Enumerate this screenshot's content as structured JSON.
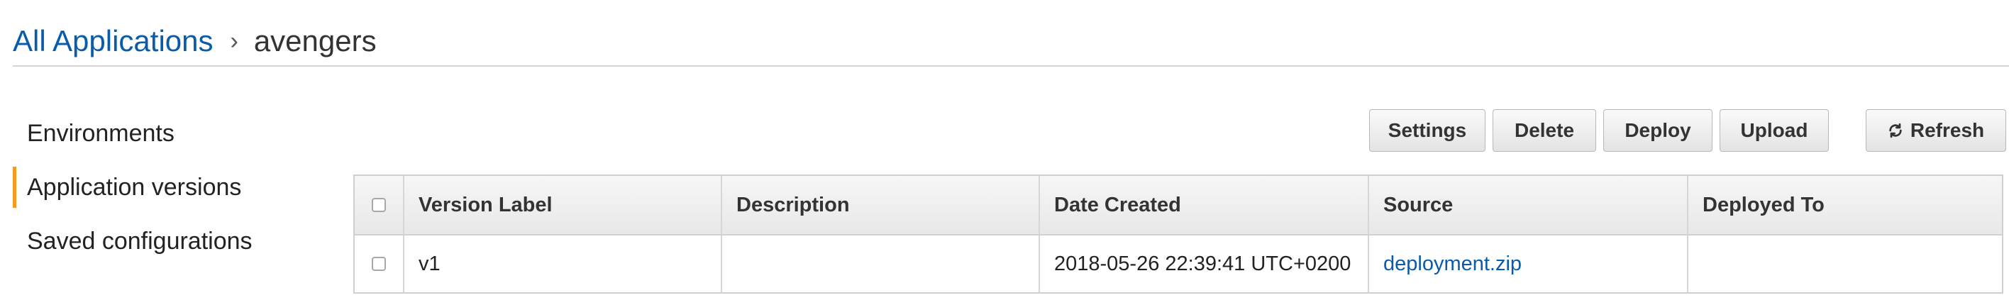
{
  "breadcrumb": {
    "root_label": "All Applications",
    "separator": "›",
    "current_label": "avengers"
  },
  "sidebar": {
    "items": [
      {
        "label": "Environments",
        "active": false
      },
      {
        "label": "Application versions",
        "active": true
      },
      {
        "label": "Saved configurations",
        "active": false
      }
    ],
    "active_accent_color": "#f59b1f"
  },
  "toolbar": {
    "settings_label": "Settings",
    "delete_label": "Delete",
    "deploy_label": "Deploy",
    "upload_label": "Upload",
    "refresh_label": "Refresh",
    "refresh_icon": "refresh-icon"
  },
  "table": {
    "columns": [
      "Version Label",
      "Description",
      "Date Created",
      "Source",
      "Deployed To"
    ],
    "rows": [
      {
        "selected": false,
        "version_label": "v1",
        "description": "",
        "date_created": "2018-05-26 22:39:41 UTC+0200",
        "source": "deployment.zip",
        "deployed_to": ""
      }
    ]
  },
  "colors": {
    "link": "#0a5ba8",
    "text": "#333333"
  }
}
